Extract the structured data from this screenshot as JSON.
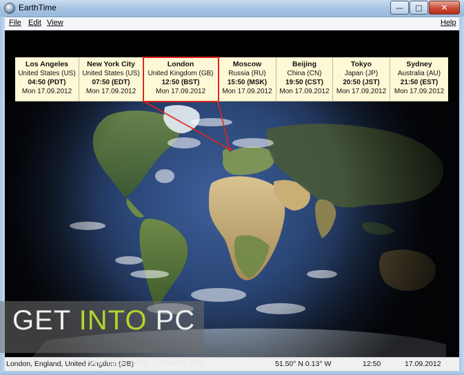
{
  "window": {
    "title": "EarthTime",
    "buttons": {
      "minimize": "—",
      "maximize": "□",
      "close": "✕"
    }
  },
  "menu": {
    "file": "File",
    "edit": "Edit",
    "view": "View",
    "help": "Help"
  },
  "cities": [
    {
      "name": "Los Angeles",
      "country": "United States (US)",
      "time": "04:50 (PDT)",
      "date": "Mon 17.09.2012"
    },
    {
      "name": "New York City",
      "country": "United States (US)",
      "time": "07:50 (EDT)",
      "date": "Mon 17.09.2012"
    },
    {
      "name": "London",
      "country": "United Kingdom (GB)",
      "time": "12:50 (BST)",
      "date": "Mon 17.09.2012"
    },
    {
      "name": "Moscow",
      "country": "Russia (RU)",
      "time": "15:50 (MSK)",
      "date": "Mon 17.09.2012"
    },
    {
      "name": "Beijing",
      "country": "China (CN)",
      "time": "19:50 (CST)",
      "date": "Mon 17.09.2012"
    },
    {
      "name": "Tokyo",
      "country": "Japan (JP)",
      "time": "20:50 (JST)",
      "date": "Mon 17.09.2012"
    },
    {
      "name": "Sydney",
      "country": "Australia (AU)",
      "time": "21:50 (EST)",
      "date": "Mon 17.09.2012"
    }
  ],
  "highlight_color": "#e0251f",
  "watermark": {
    "get": "GET ",
    "into": "INTO",
    "pc": " PC",
    "sub": "Download Latest Software App"
  },
  "status": {
    "location": "London, England, United Kingdom (GB)",
    "coords": "51.50° N  0.13° W",
    "time": "12:50",
    "date": "17.09.2012"
  }
}
